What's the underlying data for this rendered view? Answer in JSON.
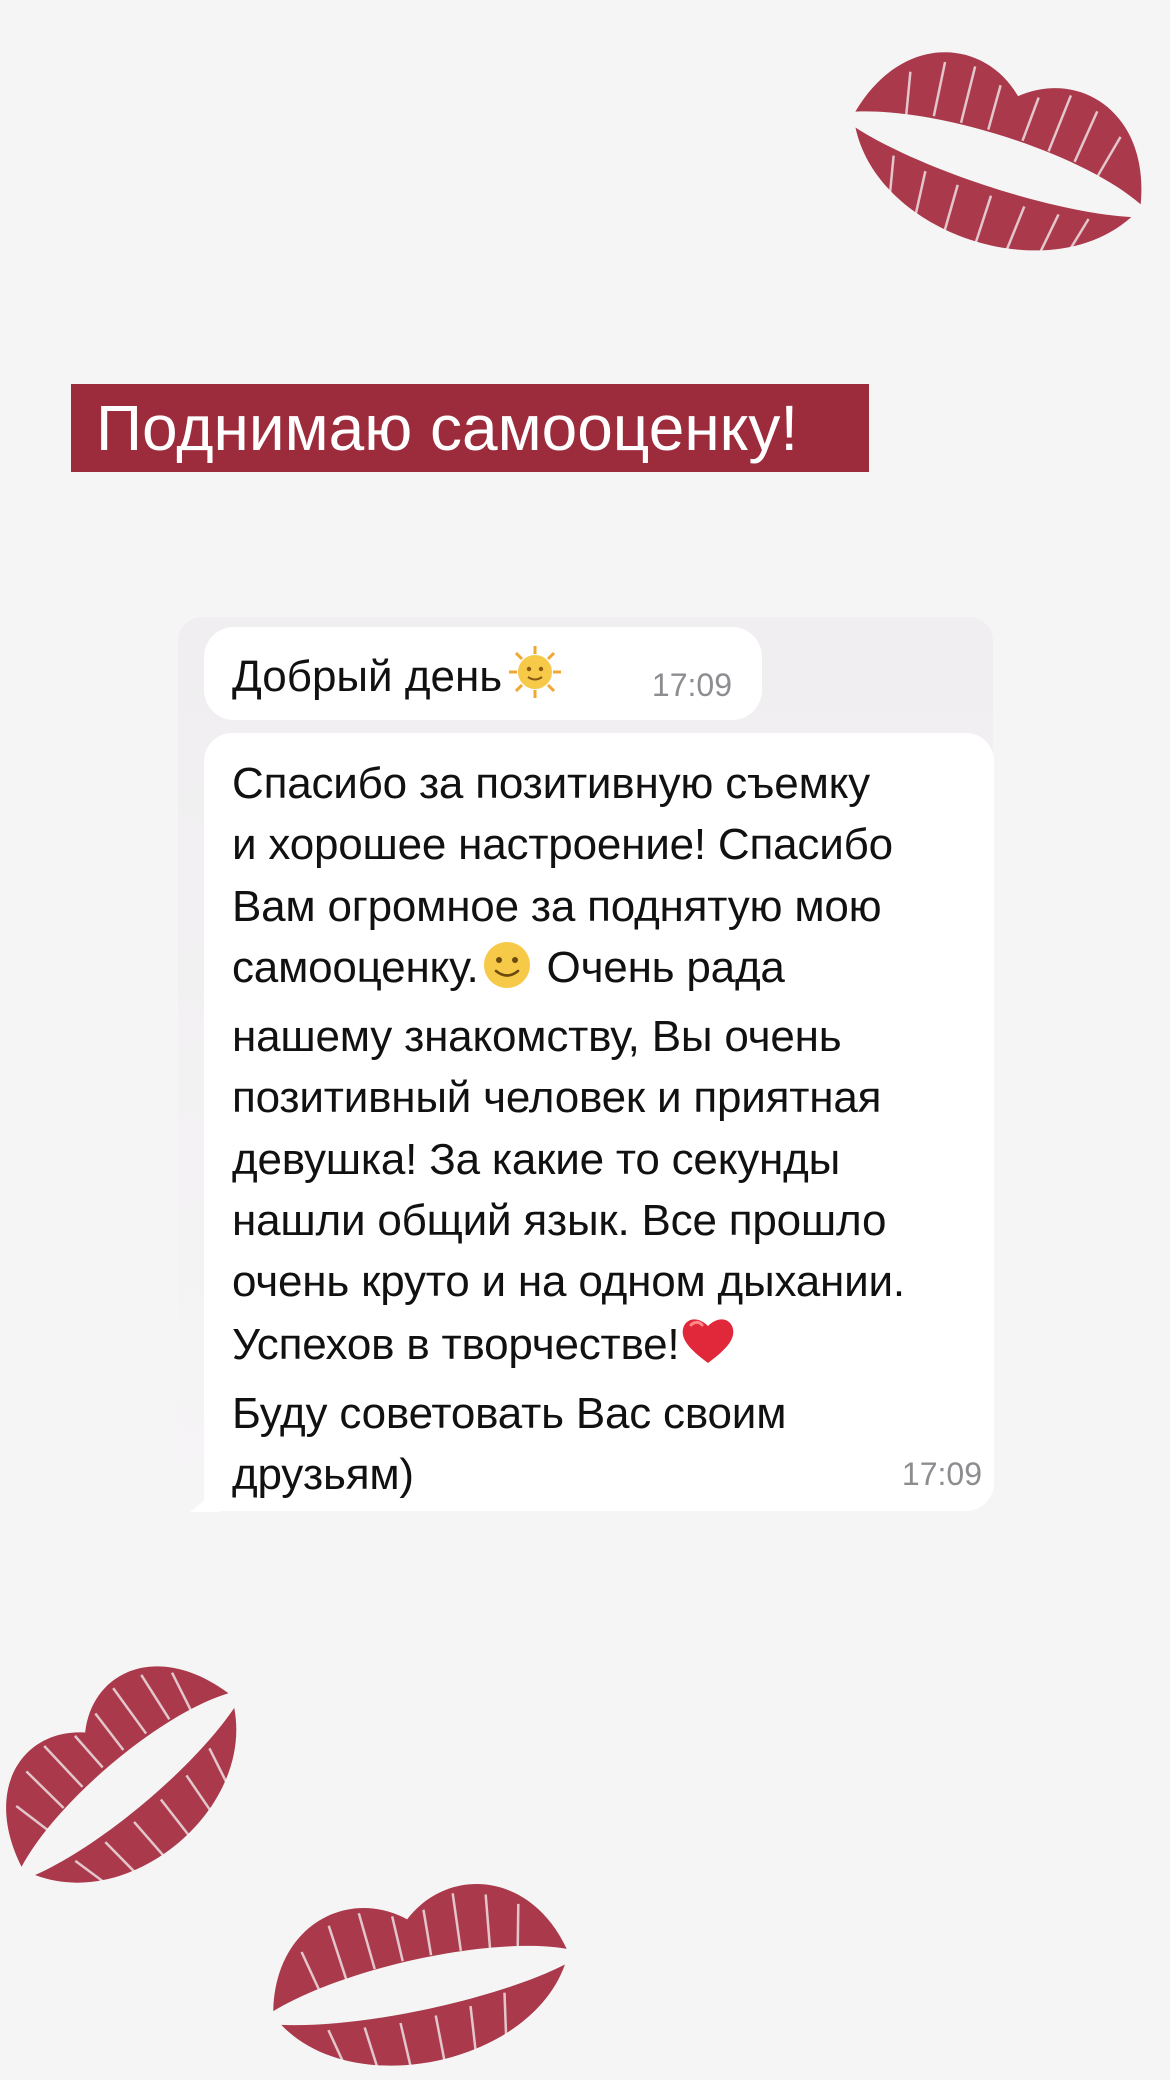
{
  "banner": {
    "title": "Поднимаю самооценку!"
  },
  "colors": {
    "banner_bg": "#9c2b3b",
    "lipstick": "#a3293c",
    "background": "#f6f5f6",
    "timestamp": "#8d8d91"
  },
  "decorations": [
    "lipstick-kiss-icon",
    "lipstick-kiss-icon",
    "lipstick-kiss-icon"
  ],
  "chat": {
    "messages": [
      {
        "text": "Добрый день",
        "emoji": "sun-with-face-icon",
        "time": "17:09"
      },
      {
        "lines": [
          "Спасибо за позитивную съемку",
          "и хорошее настроение! Спасибо",
          "Вам огромное за поднятую мою",
          "самооценку.",
          "Очень рада",
          "нашему знакомству, Вы очень",
          "позитивный человек и приятная",
          "девушка! За какие то секунды",
          "нашли общий язык.  Все прошло",
          "очень круто и на одном дыхании.",
          "Успехов в творчестве!",
          "Буду советовать Вас своим",
          "друзьям)"
        ],
        "emojis": [
          "slightly-smiling-face-icon",
          "red-heart-icon"
        ],
        "time": "17:09"
      }
    ]
  }
}
